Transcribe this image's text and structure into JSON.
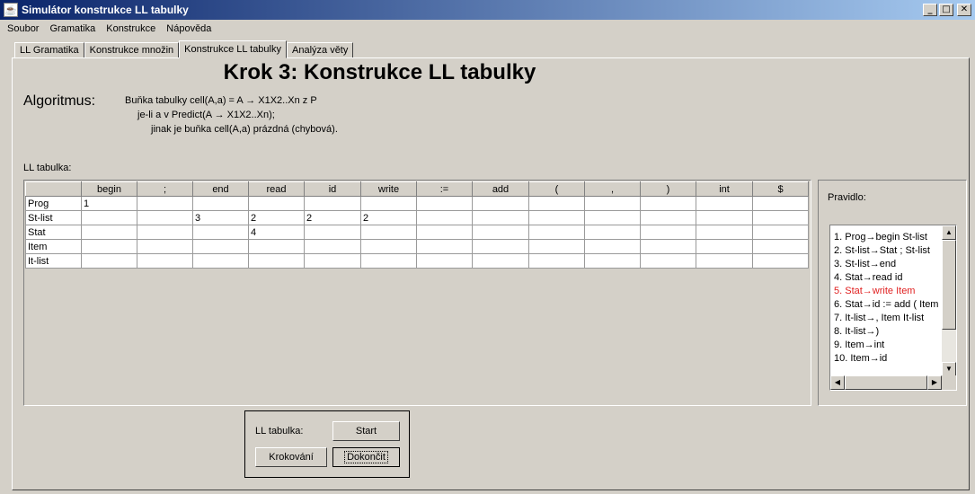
{
  "window": {
    "title": "Simulátor konstrukce LL tabulky",
    "app_icon": "java-cup-icon",
    "buttons": {
      "minimize": "_",
      "maximize": "□",
      "close": "✕"
    }
  },
  "menu": [
    "Soubor",
    "Gramatika",
    "Konstrukce",
    "Nápověda"
  ],
  "tabs": [
    "LL Gramatika",
    "Konstrukce množin",
    "Konstrukce LL tabulky",
    "Analýza věty"
  ],
  "active_tab": "Konstrukce LL tabulky",
  "step_title": "Krok 3: Konstrukce LL tabulky",
  "algorithm": {
    "label": "Algoritmus:",
    "line1": "Buňka tabulky cell(A,a) = A → X1X2..Xn z P",
    "line2": "je-li a v Predict(A → X1X2..Xn);",
    "line3": "jinak je buňka cell(A,a) prázdná (chybová)."
  },
  "table": {
    "caption": "LL tabulka:",
    "columns": [
      "",
      "begin",
      ";",
      "end",
      "read",
      "id",
      "write",
      ":=",
      "add",
      "(",
      ",",
      ")",
      "int",
      "$"
    ],
    "rows": [
      [
        "Prog",
        "1",
        "",
        "",
        "",
        "",
        "",
        "",
        "",
        "",
        "",
        "",
        "",
        ""
      ],
      [
        "St-list",
        "",
        "",
        "3",
        "2",
        "2",
        "2",
        "",
        "",
        "",
        "",
        "",
        "",
        ""
      ],
      [
        "Stat",
        "",
        "",
        "",
        "4",
        "",
        "",
        "",
        "",
        "",
        "",
        "",
        "",
        ""
      ],
      [
        "Item",
        "",
        "",
        "",
        "",
        "",
        "",
        "",
        "",
        "",
        "",
        "",
        "",
        ""
      ],
      [
        "It-list",
        "",
        "",
        "",
        "",
        "",
        "",
        "",
        "",
        "",
        "",
        "",
        "",
        ""
      ]
    ]
  },
  "rules": {
    "caption": "Pravidlo:",
    "items": [
      "1. Prog→begin St-list",
      "2. St-list→Stat ; St-list",
      "3. St-list→end",
      "4. Stat→read id",
      "5. Stat→write Item",
      "6. Stat→id := add ( Item",
      "7. It-list→, Item It-list",
      "8. It-list→)",
      "9. Item→int",
      "10. Item→id"
    ],
    "highlighted_index": 4,
    "highlight_color": "#e02020"
  },
  "controls": {
    "label": "LL tabulka:",
    "start": "Start",
    "step": "Krokování",
    "finish": "Dokončit"
  }
}
